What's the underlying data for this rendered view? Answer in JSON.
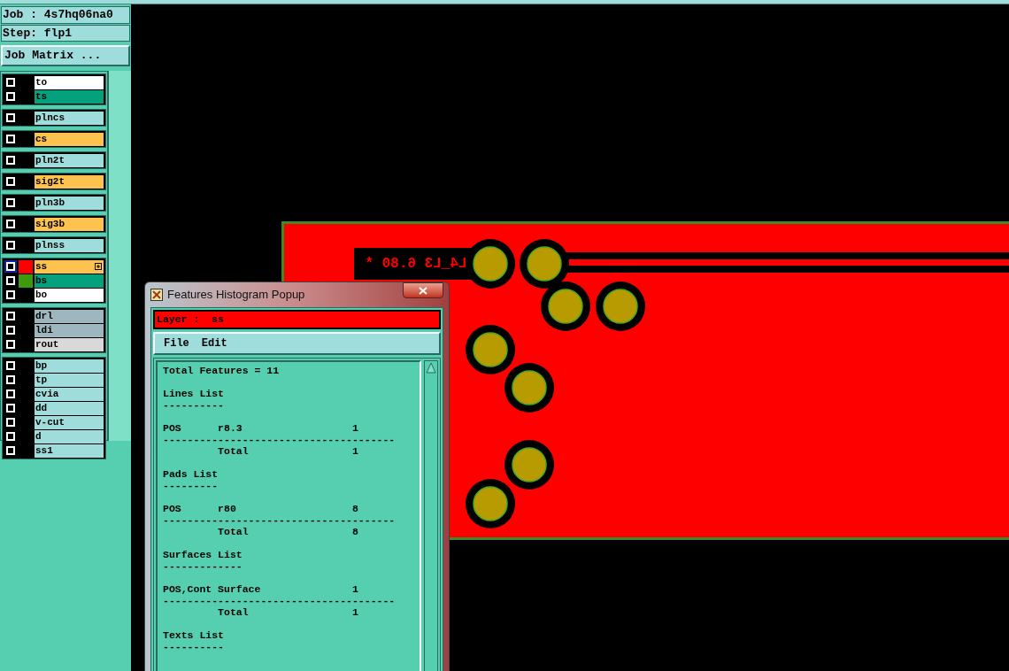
{
  "job_panel": {
    "job": "Job : 4s7hq06na0",
    "step": "Step: flp1",
    "matrix_button": "Job Matrix ..."
  },
  "layer_groups": [
    {
      "layers": [
        {
          "name": "to",
          "color": "#ffffff",
          "selected": false
        },
        {
          "name": "ts",
          "color": "#05a17d",
          "selected": false
        }
      ]
    },
    {
      "layers": [
        {
          "name": "plncs",
          "color": "#9fdcdc",
          "selected": false
        }
      ]
    },
    {
      "layers": [
        {
          "name": "cs",
          "color": "#fec34f",
          "selected": false
        }
      ]
    },
    {
      "layers": [
        {
          "name": "pln2t",
          "color": "#9fdcdc",
          "selected": false
        }
      ]
    },
    {
      "layers": [
        {
          "name": "sig2t",
          "color": "#fec34f",
          "selected": false
        }
      ]
    },
    {
      "layers": [
        {
          "name": "pln3b",
          "color": "#9fdcdc",
          "selected": false
        }
      ]
    },
    {
      "layers": [
        {
          "name": "sig3b",
          "color": "#fec34f",
          "selected": false
        }
      ]
    },
    {
      "layers": [
        {
          "name": "plnss",
          "color": "#9fdcdc",
          "selected": false
        }
      ]
    },
    {
      "layers": [
        {
          "name": "ss",
          "color": "#fec34f",
          "selected": true,
          "swatch": {
            "color": "#ff0000"
          }
        },
        {
          "name": "bs",
          "color": "#05a17d",
          "selected": false,
          "swatch": {
            "color": "#3c9a0c"
          }
        },
        {
          "name": "bo",
          "color": "#ffffff",
          "selected": false
        }
      ]
    },
    {
      "layers": [
        {
          "name": "drl",
          "color": "#9eb6bd",
          "selected": false
        },
        {
          "name": "ldi",
          "color": "#9eb6bd",
          "selected": false
        },
        {
          "name": "rout",
          "color": "#d9d9d9",
          "selected": false
        }
      ]
    },
    {
      "layers": [
        {
          "name": "bp",
          "color": "#9fdcdc",
          "selected": false
        },
        {
          "name": "tp",
          "color": "#9fdcdc",
          "selected": false
        },
        {
          "name": "cvia",
          "color": "#9fdcdc",
          "selected": false
        },
        {
          "name": "dd",
          "color": "#9fdcdc",
          "selected": false
        },
        {
          "name": "v-cut",
          "color": "#9fdcdc",
          "selected": false
        },
        {
          "name": "d",
          "color": "#9fdcdc",
          "selected": false
        },
        {
          "name": "ss1",
          "color": "#9fdcdc",
          "selected": false
        }
      ]
    }
  ],
  "board": {
    "silk_text": "L4_L3 6.80 *"
  },
  "popup": {
    "title": "Features Histogram Popup",
    "layer": "Layer :  ss",
    "menu": [
      "File",
      "Edit"
    ],
    "lines": [
      {
        "kind": "text",
        "text": "Total Features = 11"
      },
      {
        "kind": "gap"
      },
      {
        "kind": "text",
        "text": "Lines List"
      },
      {
        "kind": "text",
        "text": "----------"
      },
      {
        "kind": "gap"
      },
      {
        "kind": "text",
        "text": "POS      r8.3                  1"
      },
      {
        "kind": "text",
        "text": "--------------------------------------"
      },
      {
        "kind": "text",
        "text": "         Total                 1"
      },
      {
        "kind": "gap"
      },
      {
        "kind": "text",
        "text": "Pads List"
      },
      {
        "kind": "text",
        "text": "---------"
      },
      {
        "kind": "gap"
      },
      {
        "kind": "text",
        "text": "POS      r80                   8"
      },
      {
        "kind": "text",
        "text": "--------------------------------------"
      },
      {
        "kind": "text",
        "text": "         Total                 8"
      },
      {
        "kind": "gap"
      },
      {
        "kind": "text",
        "text": "Surfaces List"
      },
      {
        "kind": "text",
        "text": "-------------"
      },
      {
        "kind": "gap"
      },
      {
        "kind": "text",
        "text": "POS,Cont Surface               1"
      },
      {
        "kind": "text",
        "text": "--------------------------------------"
      },
      {
        "kind": "text",
        "text": "         Total                 1"
      },
      {
        "kind": "gap"
      },
      {
        "kind": "text",
        "text": "Texts List"
      },
      {
        "kind": "text",
        "text": "----------"
      }
    ]
  }
}
